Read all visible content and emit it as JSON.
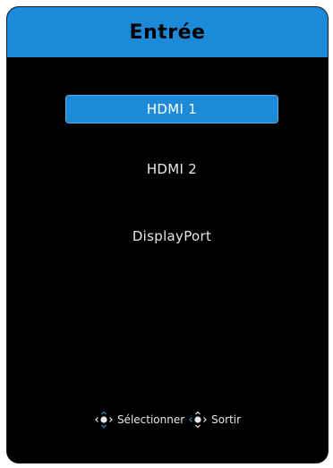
{
  "menu": {
    "title": "Entrée",
    "items": [
      {
        "label": "HDMI 1",
        "selected": true
      },
      {
        "label": "HDMI 2",
        "selected": false
      },
      {
        "label": "DisplayPort",
        "selected": false
      }
    ]
  },
  "footer": {
    "select_label": "Sélectionner",
    "exit_label": "Sortir",
    "select_icon": "joystick-4way-icon",
    "exit_icon": "joystick-3way-icon"
  },
  "colors": {
    "accent": "#1c8ad8",
    "background": "#000000",
    "text": "#e6e6e6"
  }
}
